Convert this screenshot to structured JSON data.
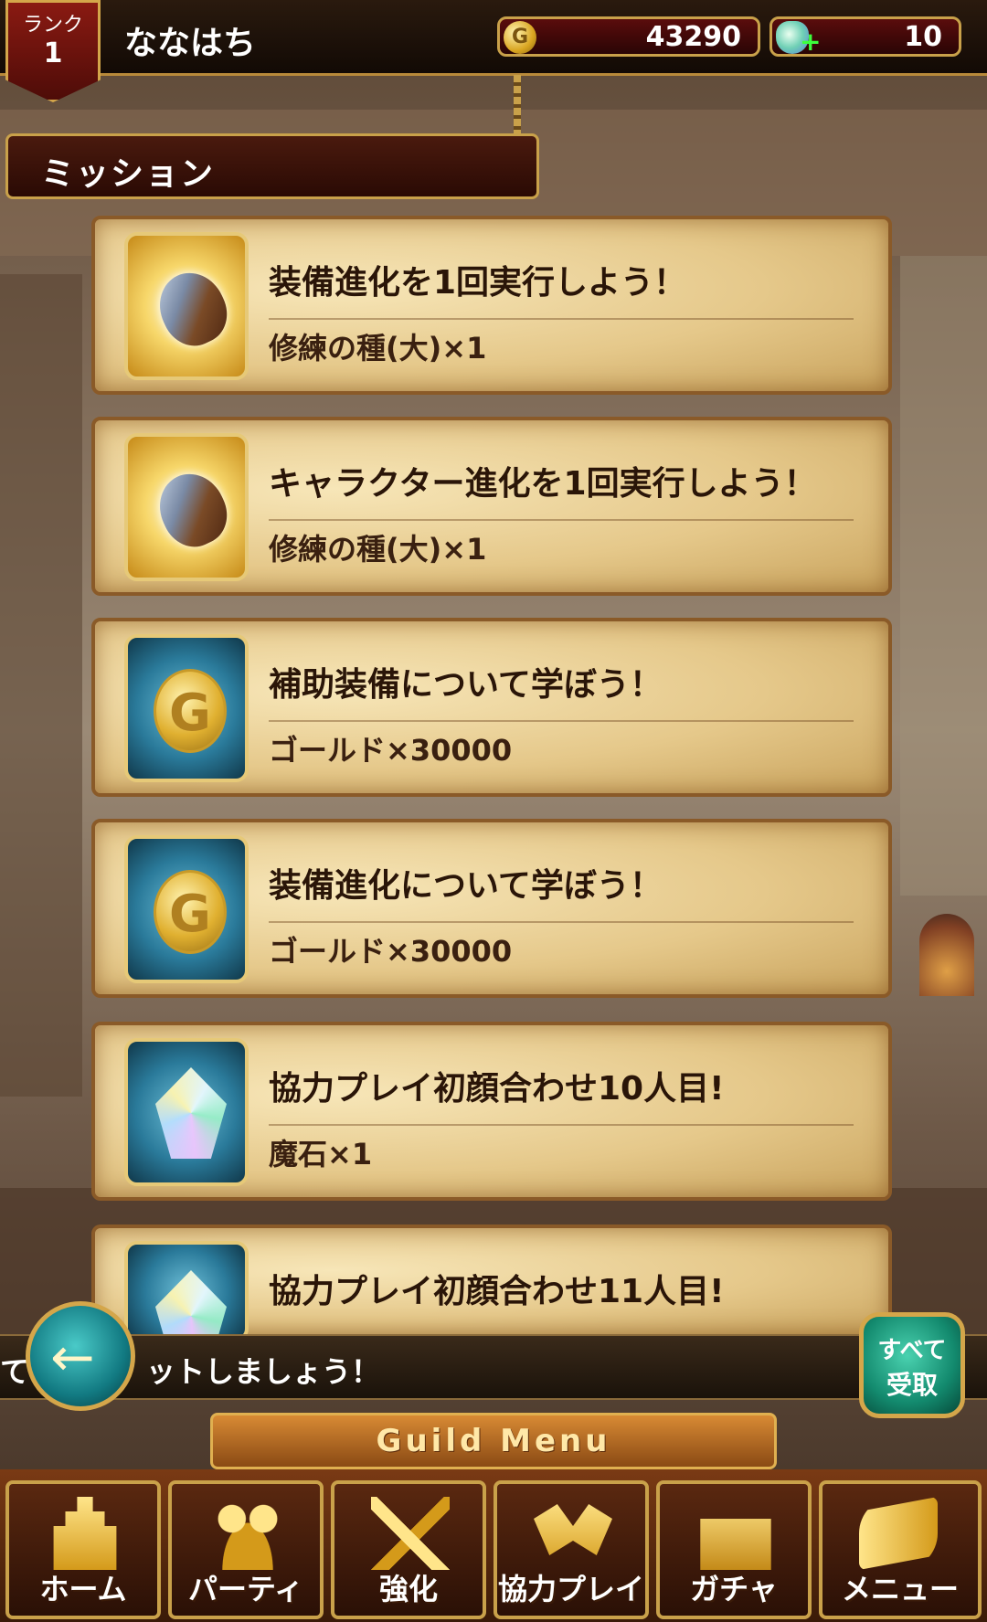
{
  "header": {
    "rank_label": "ランク",
    "rank_value": "1",
    "player_name": "ななはち",
    "gold_icon_letter": "G",
    "gold_amount": "43290",
    "gem_plus": "+",
    "gem_amount": "10"
  },
  "section_title": "ミッション",
  "missions": [
    {
      "icon": "seed-icon",
      "title": "装備進化を1回実行しよう！",
      "reward": "修練の種(大)×1"
    },
    {
      "icon": "seed-icon",
      "title": "キャラクター進化を1回実行しよう！",
      "reward": "修練の種(大)×1"
    },
    {
      "icon": "gold-coin-icon",
      "icon_letter": "G",
      "title": "補助装備について学ぼう！",
      "reward": "ゴールド×30000"
    },
    {
      "icon": "gold-coin-icon",
      "icon_letter": "G",
      "title": "装備進化について学ぼう！",
      "reward": "ゴールド×30000"
    },
    {
      "icon": "magic-stone-icon",
      "title": "協力プレイ初顔合わせ10人目!",
      "reward": "魔石×1"
    },
    {
      "icon": "magic-stone-icon",
      "title": "協力プレイ初顔合わせ11人目!",
      "reward": ""
    }
  ],
  "message_bar": {
    "text": "て　　　　ットしましょう！"
  },
  "back_button": {
    "glyph": "←"
  },
  "claim_all_button": {
    "line1": "すべて",
    "line2": "受取"
  },
  "guild_menu": {
    "banner": "Guild Menu",
    "items": [
      {
        "icon": "castle-icon",
        "label": "ホーム"
      },
      {
        "icon": "party-icon",
        "label": "パーティ"
      },
      {
        "icon": "swords-icon",
        "label": "強化"
      },
      {
        "icon": "handshake-icon",
        "label": "協力プレイ"
      },
      {
        "icon": "treasure-chest-icon",
        "label": "ガチャ"
      },
      {
        "icon": "scroll-icon",
        "label": "メニュー"
      }
    ]
  },
  "colors": {
    "accent_gold": "#c9a14a",
    "card_parchment": "#e5c88a",
    "header_dark": "#2a1a0e"
  }
}
